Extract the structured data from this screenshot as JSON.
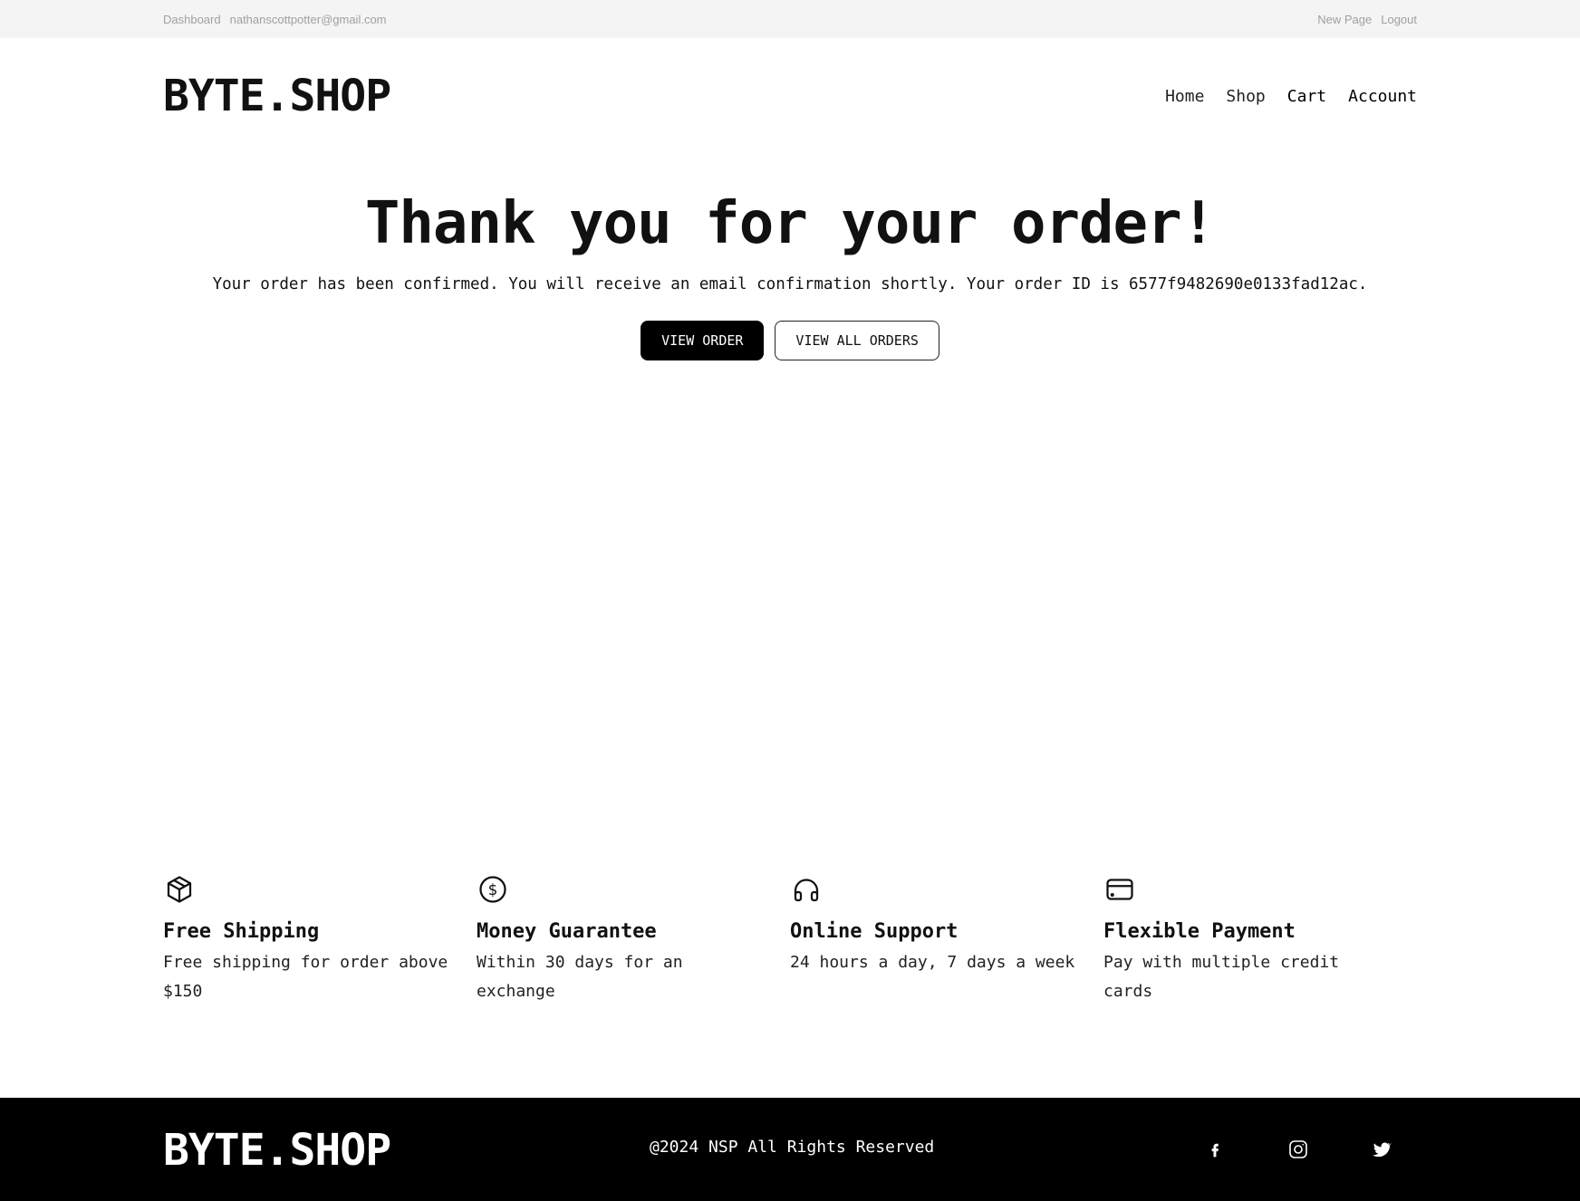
{
  "topbar": {
    "dashboard": "Dashboard",
    "email": "nathanscottpotter@gmail.com",
    "new_page": "New Page",
    "logout": "Logout"
  },
  "header": {
    "logo": "BYTE.SHOP",
    "nav": [
      "Home",
      "Shop",
      "Cart",
      "Account"
    ]
  },
  "hero": {
    "title": "Thank you for your order!",
    "message": "Your order has been confirmed. You will receive an email confirmation shortly. Your order ID is 6577f9482690e0133fad12ac.",
    "view_order": "VIEW ORDER",
    "view_all_orders": "VIEW ALL ORDERS"
  },
  "features": [
    {
      "icon": "package-icon",
      "title": "Free Shipping",
      "text": "Free shipping for order above $150"
    },
    {
      "icon": "dollar-circle-icon",
      "title": "Money Guarantee",
      "text": "Within 30 days for an exchange"
    },
    {
      "icon": "headphones-icon",
      "title": "Online Support",
      "text": "24 hours a day, 7 days a week"
    },
    {
      "icon": "credit-card-icon",
      "title": "Flexible Payment",
      "text": "Pay with multiple credit cards"
    }
  ],
  "footer": {
    "logo": "BYTE.SHOP",
    "copyright": "@2024 NSP All Rights Reserved",
    "social": [
      "facebook-icon",
      "instagram-icon",
      "twitter-icon"
    ]
  }
}
